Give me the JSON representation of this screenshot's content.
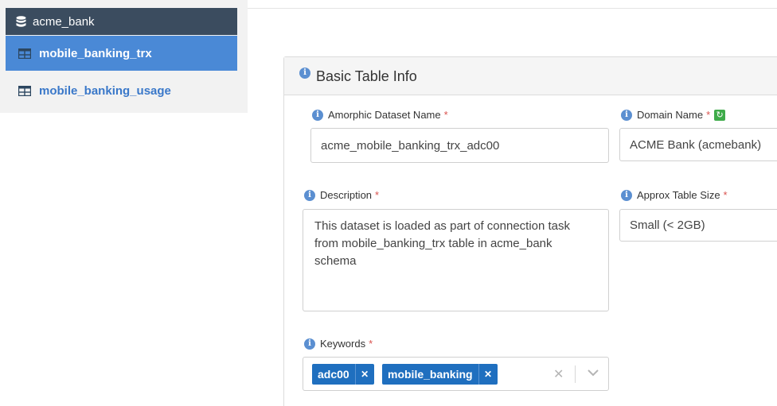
{
  "sidebar": {
    "schema": {
      "label": "acme_bank",
      "icon": "database-icon"
    },
    "items": [
      {
        "label": "mobile_banking_trx",
        "icon": "table-icon",
        "active": true
      },
      {
        "label": "mobile_banking_usage",
        "icon": "table-icon",
        "active": false
      }
    ]
  },
  "panel": {
    "title": "Basic Table Info",
    "dataset_name": {
      "label": "Amorphic Dataset Name",
      "value": "acme_mobile_banking_trx_adc00"
    },
    "domain_name": {
      "label": "Domain Name",
      "value": "ACME Bank (acmebank)"
    },
    "description": {
      "label": "Description",
      "lines": [
        "This dataset is loaded as part of connection task",
        "from mobile_banking_trx table in acme_bank",
        "schema"
      ]
    },
    "table_size": {
      "label": "Approx Table Size",
      "value": "Small (< 2GB)"
    },
    "keywords": {
      "label": "Keywords",
      "tags": [
        "adc00",
        "mobile_banking"
      ]
    },
    "required_mark": "*"
  },
  "colors": {
    "sidebar_dark": "#3b4c5f",
    "sidebar_active": "#4a89d6",
    "tag": "#1f6fbf",
    "required": "#d9534f",
    "refresh": "#3eab4a"
  }
}
